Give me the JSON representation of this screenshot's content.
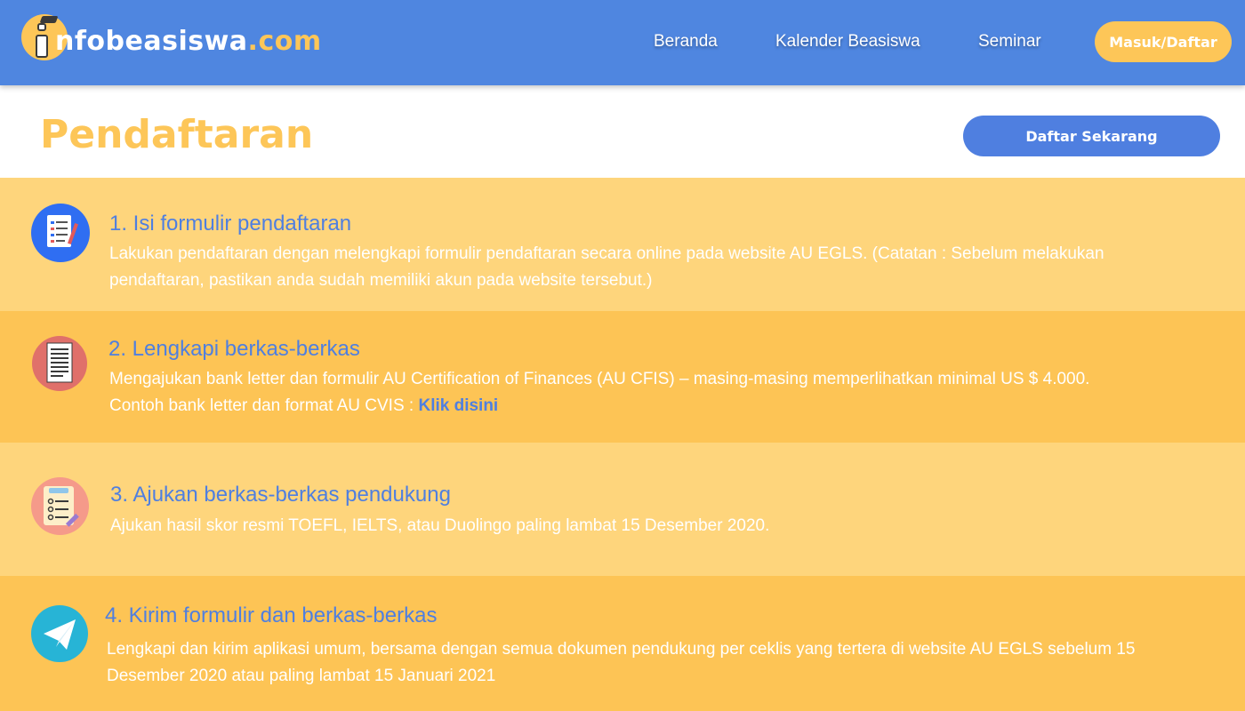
{
  "brand": {
    "name_main": "nfobeasiswa",
    "name_domain": ".com",
    "badge_letter": "i"
  },
  "nav": {
    "items": [
      {
        "label": "Beranda"
      },
      {
        "label": "Kalender Beasiswa"
      },
      {
        "label": "Seminar"
      }
    ],
    "login_label": "Masuk/Daftar"
  },
  "page": {
    "title": "Pendaftaran",
    "cta_label": "Daftar Sekarang"
  },
  "steps": [
    {
      "title": "1. Isi formulir pendaftaran",
      "desc": "Lakukan pendaftaran dengan melengkapi formulir pendaftaran secara online pada website AU EGLS. (Catatan : Sebelum melakukan pendaftaran, pastikan anda sudah memiliki akun pada website tersebut.)",
      "icon": "form-icon"
    },
    {
      "title": "2. Lengkapi berkas-berkas",
      "desc": "Mengajukan bank letter dan formulir AU Certification of Finances (AU CFIS) – masing-masing memperlihatkan minimal US $ 4.000. Contoh bank letter dan format AU CVIS : ",
      "link_label": "Klik disini",
      "icon": "document-icon"
    },
    {
      "title": "3. Ajukan berkas-berkas pendukung",
      "desc": "Ajukan hasil skor resmi TOEFL, IELTS, atau Duolingo paling lambat 15 Desember 2020.",
      "icon": "checklist-icon"
    },
    {
      "title": "4. Kirim formulir dan berkas-berkas",
      "desc": "Lengkapi dan kirim aplikasi umum, bersama dengan semua dokumen pendukung per ceklis yang tertera di website AU EGLS sebelum 15 Desember 2020 atau paling lambat 15 Januari 2021",
      "icon": "paper-plane-icon"
    }
  ],
  "colors": {
    "header_bg": "#4f86e0",
    "accent_yellow": "#fdc658",
    "step_light": "#fed57c",
    "step_dark": "#fdc455",
    "link_blue": "#4f7fe0"
  }
}
